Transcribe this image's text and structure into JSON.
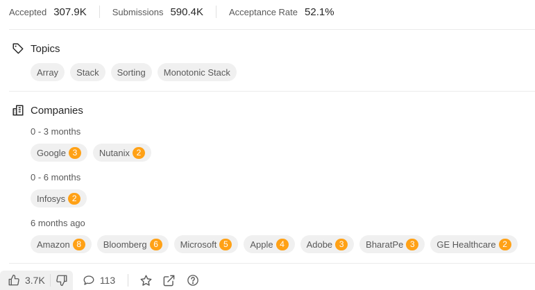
{
  "stats": [
    {
      "label": "Accepted",
      "value": "307.9K"
    },
    {
      "label": "Submissions",
      "value": "590.4K"
    },
    {
      "label": "Acceptance Rate",
      "value": "52.1%"
    }
  ],
  "topics": {
    "title": "Topics",
    "icon": "tag-icon",
    "tags": [
      "Array",
      "Stack",
      "Sorting",
      "Monotonic Stack"
    ]
  },
  "companies": {
    "title": "Companies",
    "icon": "building-icon",
    "badge_color": "#ffa116",
    "groups": [
      {
        "period": "0 - 3 months",
        "items": [
          {
            "name": "Google",
            "count": "3"
          },
          {
            "name": "Nutanix",
            "count": "2"
          }
        ]
      },
      {
        "period": "0 - 6 months",
        "items": [
          {
            "name": "Infosys",
            "count": "2"
          }
        ]
      },
      {
        "period": "6 months ago",
        "items": [
          {
            "name": "Amazon",
            "count": "8"
          },
          {
            "name": "Bloomberg",
            "count": "6"
          },
          {
            "name": "Microsoft",
            "count": "5"
          },
          {
            "name": "Apple",
            "count": "4"
          },
          {
            "name": "Adobe",
            "count": "3"
          },
          {
            "name": "BharatPe",
            "count": "3"
          },
          {
            "name": "GE Healthcare",
            "count": "2"
          }
        ]
      }
    ]
  },
  "actions": {
    "likes": "3.7K",
    "comments": "113"
  }
}
